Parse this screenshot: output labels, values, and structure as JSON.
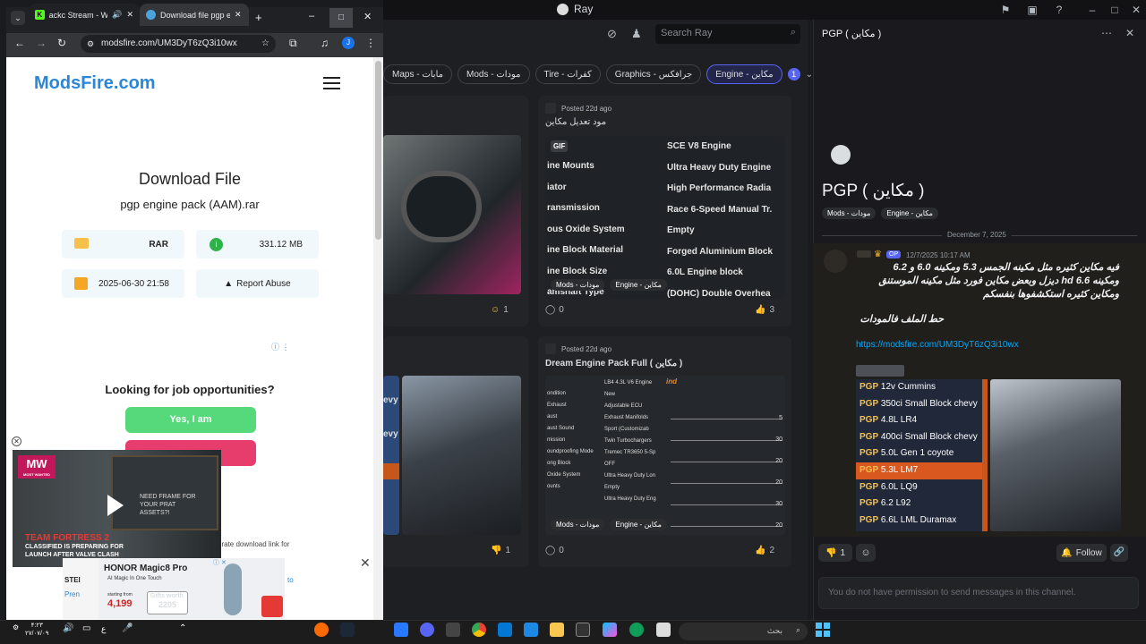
{
  "discord": {
    "window_title": "Ray",
    "search_placeholder": "Search Ray",
    "tags": [
      "Maps - مابات",
      "Mods - مودات",
      "Tire - كفرات",
      "Graphics - جرافكس",
      "Engine - مكاين"
    ],
    "tag_count": "1",
    "cards": [
      {
        "posted": "",
        "title": "",
        "reaction_count": "1",
        "comments": ""
      },
      {
        "posted": "Posted 22d ago",
        "title": "مود تعديل مكاين",
        "gif_badge": "GIF",
        "left_list": [
          "ine Mounts",
          "iator",
          "ransmission",
          "ous Oxide System",
          "ine Block Material",
          "ine Block Size",
          "amshaft Type"
        ],
        "right_list": [
          "SCE V8 Engine",
          "Ultra Heavy Duty Engine",
          "High Performance Radia",
          "Race 6-Speed Manual Tr.",
          "Empty",
          "Forged Aluminium Block",
          "6.0L Engine block",
          "(DOHC) Double Overhea"
        ],
        "chips": [
          "Mods - مودات",
          "Engine - مكاين"
        ],
        "comments": "0",
        "reaction_count": "3"
      },
      {
        "posted": "",
        "title": "",
        "reaction_count": "1",
        "side_labels": [
          "evy",
          "evy"
        ]
      },
      {
        "posted": "Posted 22d ago",
        "title": "Dream Engine Pack Full ( مكاين )",
        "badge": "ind",
        "left_list": [
          "ondition",
          "Exhaust",
          "aust",
          "aust Sound",
          "",
          "mission",
          "oundproofing Mode",
          "ong Block",
          "Oxide System",
          "ounts"
        ],
        "right_list": [
          "LB4 4.3L V6 Engine",
          "New",
          "Adjustable ECU",
          "Exhaust Manifolds",
          "Sport (Customizab",
          "",
          "Twin Turbochargers",
          "Tremec TR3650 5-Sp",
          "OFF",
          "Ultra Heavy Duty Lon",
          "Empty",
          "Ultra Heavy Duty Eng"
        ],
        "slider_values": [
          "5",
          "30",
          "20",
          "20",
          "30",
          "20",
          "26"
        ],
        "chips": [
          "Mods - مودات",
          "Engine - مكاين"
        ],
        "comments": "0",
        "reaction_count": "2"
      }
    ],
    "thread": {
      "header": "PGP ( مكاين )",
      "title": "PGP ( مكاين )",
      "tags": [
        "Mods - مودات",
        "Engine - مكاين"
      ],
      "date_divider": "December 7, 2025",
      "author_badge": "OP",
      "timestamp": "12/7/2025 10:17 AM",
      "message_lines": [
        "فيه مكاين كثيره مثل مكينه الجمس 5.3 ومكينه 6.0 و 6.2",
        "ومكينه 6.6 hd ديزل وبعض مكاين فورد مثل مكينه الموستنق",
        "ومكاين كثيره استكشفوها بنفسكم"
      ],
      "message_line2": "حط الملف فالمودات",
      "link": "https://modsfire.com/UM3DyT6zQ3i10wx",
      "pgp_list": [
        "12v Cummins",
        "350ci Small Block chevy",
        "4.8L LR4",
        "400ci Small Block chevy",
        "5.0L Gen 1 coyote",
        "5.3L LM7",
        "6.0L LQ9",
        "6.2 L92",
        "6.6L LML Duramax"
      ],
      "pgp_prefix": "PGP",
      "pgp_selected_index": 5,
      "dislike_count": "1",
      "follow_label": "Follow",
      "composer_text": "You do not have permission to send messages in this channel."
    }
  },
  "chrome": {
    "tabs": [
      {
        "label": "ackc Stream - Wa"
      },
      {
        "label": "Download file pgp en"
      }
    ],
    "url": "modsfire.com/UM3DyT6zQ3i10wx",
    "page": {
      "logo": "ModsFire.com",
      "heading": "Download File",
      "filename": "pgp engine pack (AAM).rar",
      "file_type": "RAR",
      "file_size": "331.12 MB",
      "date": "2025-06-30 21:58",
      "report": "Report Abuse",
      "job_question": "Looking for job opportunities?",
      "yes_button": "Yes, I am",
      "generate_text": "erate download link for",
      "video_brand": "MW",
      "video_brand_sub": "MOST WANTED",
      "video_headline_1": "TEAM FORTRESS 2",
      "video_headline_2": "CLASSIFIED IS PREPARING FOR",
      "video_headline_3": "LAUNCH AFTER VALVE CLASH",
      "video_board": "NEED FRAME FOR YOUR PRAT ASSETS?!",
      "ad_brand": "HONOR Magic8 Pro",
      "ad_sub": "AI Magic In One Touch",
      "ad_starting": "starting from",
      "ad_price": "4,199",
      "ad_gifts": "Gifts worth",
      "ad_gift_price": "2205",
      "ad_left1": "STEI",
      "ad_left2": "Pren",
      "ad_right": "to"
    }
  },
  "taskbar": {
    "time": "۴:۲۳",
    "date": "۲۷/۰۷/۰۹",
    "lang": "ع",
    "search_placeholder": "بحث"
  }
}
